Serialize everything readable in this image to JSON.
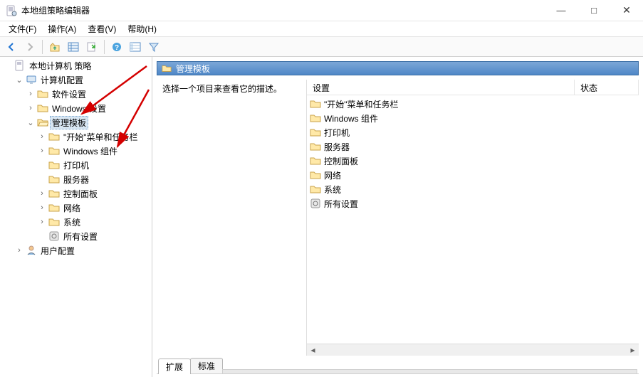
{
  "window": {
    "title": "本地组策略编辑器",
    "min_label": "—",
    "max_label": "□",
    "close_label": "✕"
  },
  "menu": {
    "file": "文件(F)",
    "action": "操作(A)",
    "view": "查看(V)",
    "help": "帮助(H)"
  },
  "toolbar": {
    "back": "back-arrow",
    "forward": "forward-arrow",
    "up": "up-folder",
    "list": "list-view",
    "props": "properties",
    "help": "help",
    "details": "details-view",
    "filter": "filter-funnel"
  },
  "tree": {
    "root": "本地计算机 策略",
    "computer": "计算机配置",
    "software": "软件设置",
    "windows": "Windows 设置",
    "admin": "管理模板",
    "start_taskbar": "\"开始\"菜单和任务栏",
    "components": "Windows 组件",
    "printers": "打印机",
    "servers": "服务器",
    "control_panel": "控制面板",
    "network": "网络",
    "system": "系统",
    "all_settings": "所有设置",
    "user": "用户配置"
  },
  "right": {
    "header": "管理模板",
    "hint": "选择一个项目来查看它的描述。",
    "col_setting": "设置",
    "col_state": "状态",
    "items": {
      "start_taskbar": "\"开始\"菜单和任务栏",
      "components": "Windows 组件",
      "printers": "打印机",
      "servers": "服务器",
      "control_panel": "控制面板",
      "network": "网络",
      "system": "系统",
      "all_settings": "所有设置"
    }
  },
  "tabs": {
    "extended": "扩展",
    "standard": "标准"
  }
}
